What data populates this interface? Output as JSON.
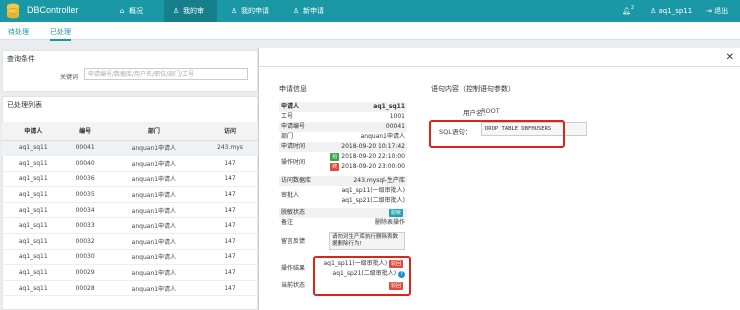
{
  "app": {
    "title": "DBController"
  },
  "nav": {
    "overview": "概况",
    "my_approval": "我的审批",
    "my_request": "我的申请",
    "new_request": "新申请"
  },
  "topright": {
    "notif_count": "2",
    "user": "aq1_sp11",
    "logout": "退出"
  },
  "subtabs": {
    "pending": "待处理",
    "done": "已处理"
  },
  "query": {
    "title": "查询条件",
    "keyword_label": "关键词",
    "placeholder": "申请编号/数据库/用户名/职位/部门/工号"
  },
  "list": {
    "title": "已处理列表",
    "headers": [
      "申请人",
      "编号",
      "部门",
      "访问"
    ],
    "rows": [
      [
        "aq1_sq11",
        "00041",
        "anquan1申请人",
        "243.mys"
      ],
      [
        "aq1_sq11",
        "00040",
        "anquan1申请人",
        "147"
      ],
      [
        "aq1_sq11",
        "00036",
        "anquan1申请人",
        "147"
      ],
      [
        "aq1_sq11",
        "00035",
        "anquan1申请人",
        "147"
      ],
      [
        "aq1_sq11",
        "00034",
        "anquan1申请人",
        "147"
      ],
      [
        "aq1_sq11",
        "00033",
        "anquan1申请人",
        "147"
      ],
      [
        "aq1_sq11",
        "00032",
        "anquan1申请人",
        "147"
      ],
      [
        "aq1_sq11",
        "00030",
        "anquan1申请人",
        "147"
      ],
      [
        "aq1_sq11",
        "00029",
        "anquan1申请人",
        "147"
      ],
      [
        "aq1_sq11",
        "00028",
        "anquan1申请人",
        "147"
      ]
    ]
  },
  "detail": {
    "info_title": "申请信息",
    "applicant_label": "申请人",
    "applicant": "aq1_sq11",
    "empno_label": "工号",
    "empno": "1001",
    "reqno_label": "申请编号",
    "reqno": "00041",
    "dept_label": "部门",
    "dept": "anquan1申请人",
    "reqtime_label": "申请时间",
    "reqtime": "2018-09-20 10:17:42",
    "optime_label": "操作时间",
    "start_badge": "始",
    "start_time": "2018-09-20 22:10:00",
    "end_badge": "终",
    "end_time": "2018-09-20 23:00:00",
    "db_label": "访问数据库",
    "db": "243.mysql-生产库",
    "approver_label": "审批人",
    "approver1": "aq1_sp11(一级审批人)",
    "approver2": "aq1_sp21(二级审批人)",
    "dryrun_label": "脱敏状态",
    "dryrun_badge": "脱敏",
    "remark_label": "备注",
    "remark": "删除表操作",
    "feedback_label": "留言反馈",
    "feedback": "请勿对生产库执行删除表数据删除行为!",
    "result_label": "操作结果",
    "result1": "aq1_sp11(一级审批人)",
    "reject_badge": "驳回",
    "result2": "aq1_sp21(二级审批人)",
    "status_label": "当前状态",
    "status_badge": "驳回",
    "content_title": "语句内容（控制语句参数）",
    "username_label": "用户名：",
    "username": "ROOT",
    "sql_label": "SQL语句：",
    "sql": "DROP TABLE DBFHUSERS"
  },
  "colors": {
    "primary": "#1b98a6",
    "red": "#d9261c",
    "green": "#3aa64a",
    "teal": "#1fa2b1"
  }
}
